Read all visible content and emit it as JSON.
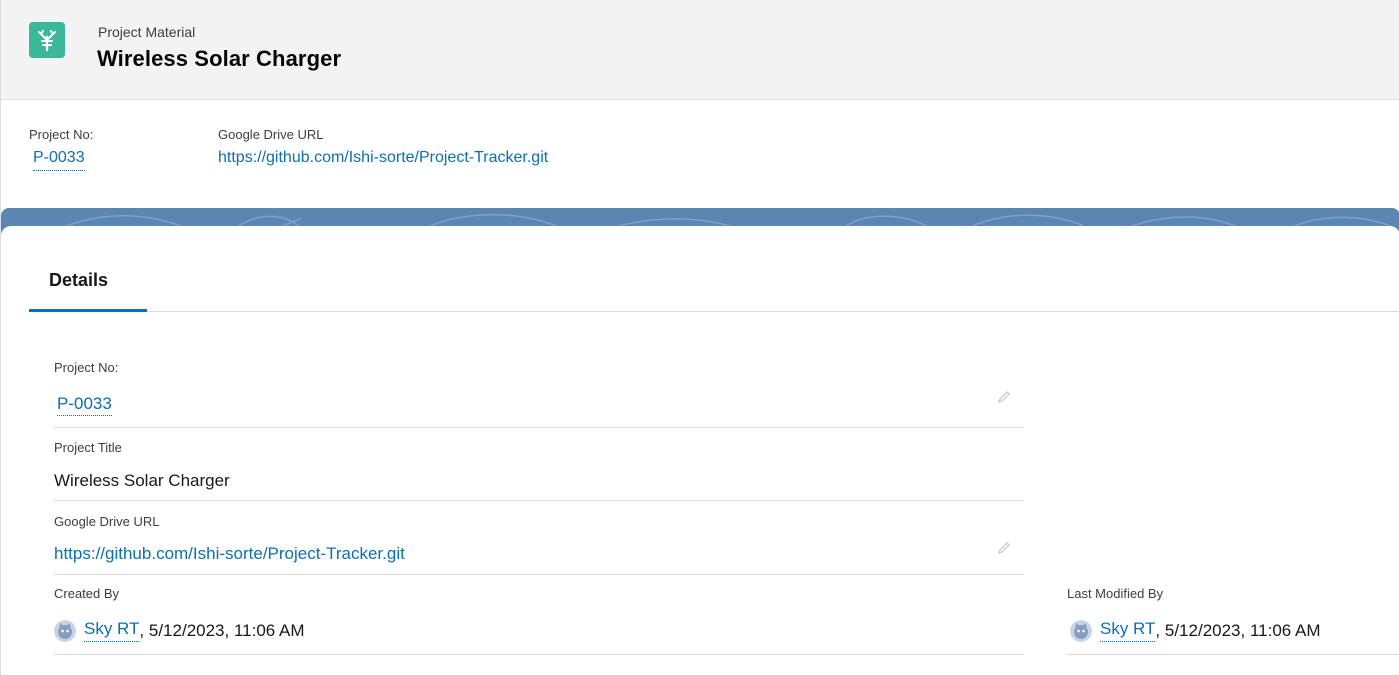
{
  "header": {
    "object_type": "Project Material",
    "record_name": "Wireless Solar Charger",
    "icon": "project-material-icon"
  },
  "highlights": {
    "project_no_label": "Project No:",
    "project_no_value": "P-0033",
    "drive_url_label": "Google Drive URL",
    "drive_url_value": "https://github.com/Ishi-sorte/Project-Tracker.git"
  },
  "tabs": [
    {
      "label": "Details",
      "active": true
    }
  ],
  "details": {
    "project_no": {
      "label": "Project No:",
      "value": "P-0033"
    },
    "project_title": {
      "label": "Project Title",
      "value": "Wireless Solar Charger"
    },
    "drive_url": {
      "label": "Google Drive URL",
      "value": "https://github.com/Ishi-sorte/Project-Tracker.git"
    },
    "created_by": {
      "label": "Created By",
      "user": "Sky RT",
      "separator": ",",
      "date": " 5/12/2023, 11:06 AM"
    },
    "last_modified_by": {
      "label": "Last Modified By",
      "user": "Sky RT",
      "separator": ",",
      "date": " 5/12/2023, 11:06 AM"
    }
  },
  "colors": {
    "icon_bg": "#3bb89a",
    "link": "#0b6fb1",
    "band": "#5b86b1"
  }
}
